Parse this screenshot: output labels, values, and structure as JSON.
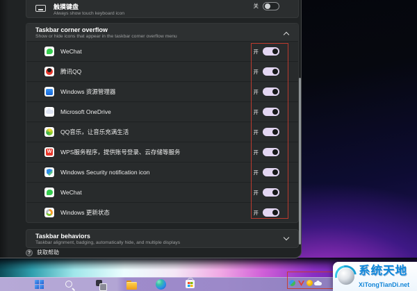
{
  "window": {
    "touch_keyboard": {
      "title": "触摸键盘",
      "subtitle": "Always show touch keyboard icon",
      "state_label": "关",
      "toggle_state": "off"
    },
    "overflow_section": {
      "title": "Taskbar corner overflow",
      "subtitle": "Show or hide icons that appear in the taskbar corner overflow menu"
    },
    "overflow_items": [
      {
        "label": "WeChat",
        "icon": "wechat-icon",
        "state_label": "开",
        "toggle_state": "on"
      },
      {
        "label": "腾讯QQ",
        "icon": "qq-icon",
        "state_label": "开",
        "toggle_state": "on"
      },
      {
        "label": "Windows 资源管理器",
        "icon": "file-explorer-icon",
        "state_label": "开",
        "toggle_state": "on"
      },
      {
        "label": "Microsoft OneDrive",
        "icon": "onedrive-icon",
        "state_label": "开",
        "toggle_state": "on"
      },
      {
        "label": "QQ音乐，让音乐充满生活",
        "icon": "qq-music-icon",
        "state_label": "开",
        "toggle_state": "on"
      },
      {
        "label": "WPS服务程序，提供账号登录、云存储等服务",
        "icon": "wps-icon",
        "state_label": "开",
        "toggle_state": "on"
      },
      {
        "label": "Windows Security notification icon",
        "icon": "windows-security-icon",
        "state_label": "开",
        "toggle_state": "on"
      },
      {
        "label": "WeChat",
        "icon": "wechat-icon",
        "state_label": "开",
        "toggle_state": "on"
      },
      {
        "label": "Windows 更新状态",
        "icon": "windows-update-icon",
        "state_label": "开",
        "toggle_state": "on"
      }
    ],
    "behaviors_section": {
      "title": "Taskbar behaviors",
      "subtitle": "Taskbar alignment, badging, automatically hide, and multiple displays"
    },
    "help_label": "获取帮助"
  },
  "taskbar": {
    "icons": [
      "start",
      "search",
      "task-view",
      "file-explorer",
      "edge",
      "store"
    ],
    "tray_icons": [
      "windows-security",
      "wps",
      "qq-music",
      "onedrive"
    ]
  },
  "watermark": {
    "title": "系统天地",
    "site": "XiTongTianDi.net"
  },
  "colors": {
    "toggle_on_accent": "#e3d6f2",
    "annotation_red": "#c43b2e",
    "taskbar_purple": "#9c89c9",
    "card_background": "#2b2e2f",
    "page_background": "#202324"
  }
}
